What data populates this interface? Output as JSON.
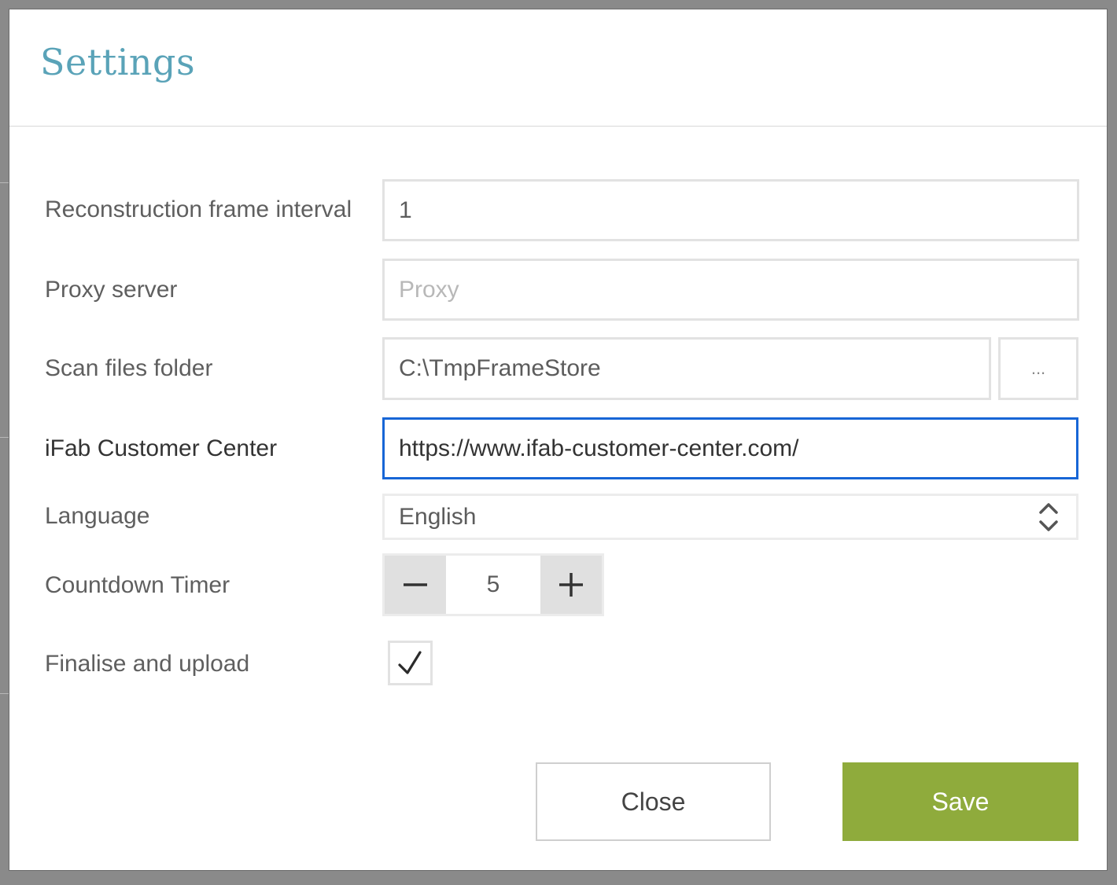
{
  "dialog": {
    "title": "Settings"
  },
  "form": {
    "reconstruction_frame_interval": {
      "label": "Reconstruction frame interval",
      "value": "1"
    },
    "proxy_server": {
      "label": "Proxy server",
      "value": "",
      "placeholder": "Proxy"
    },
    "scan_files_folder": {
      "label": "Scan files folder",
      "value": "C:\\TmpFrameStore",
      "browse_label": "..."
    },
    "customer_center": {
      "label": "iFab Customer Center",
      "value": "https://www.ifab-customer-center.com/"
    },
    "language": {
      "label": "Language",
      "selected": "English"
    },
    "countdown_timer": {
      "label": "Countdown Timer",
      "value": "5"
    },
    "finalise_and_upload": {
      "label": "Finalise and upload",
      "checked": true
    }
  },
  "buttons": {
    "close_label": "Close",
    "save_label": "Save"
  },
  "colors": {
    "title": "#5aa3b8",
    "focus_border": "#1766d6",
    "save_button": "#8fab3c"
  },
  "icons": {
    "browse": "ellipsis-icon",
    "language_select": "chevron-up-down-icon",
    "stepper_minus": "minus-icon",
    "stepper_plus": "plus-icon",
    "checkbox": "checkmark-icon"
  }
}
